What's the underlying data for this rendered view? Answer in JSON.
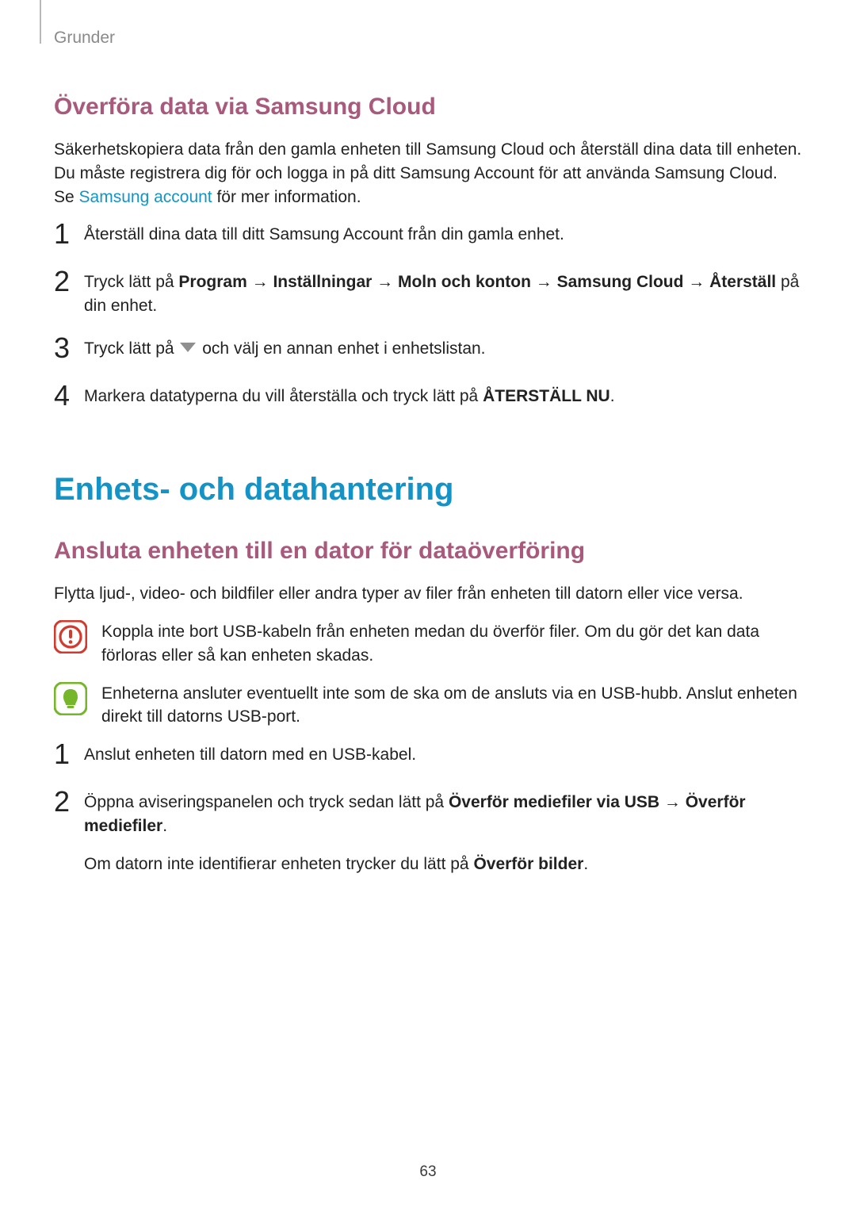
{
  "header": {
    "section_label": "Grunder"
  },
  "section1": {
    "title": "Överföra data via Samsung Cloud",
    "intro_pre": "Säkerhetskopiera data från den gamla enheten till Samsung Cloud och återställ dina data till enheten. Du måste registrera dig för och logga in på ditt Samsung Account för att använda Samsung Cloud. Se ",
    "intro_link": "Samsung account",
    "intro_post": " för mer information.",
    "steps": [
      {
        "num": "1",
        "text": "Återställ dina data till ditt Samsung Account från din gamla enhet."
      },
      {
        "num": "2",
        "pre": "Tryck lätt på ",
        "bold": "Program → Inställningar → Moln och konton → Samsung Cloud → Återställ",
        "post": " på din enhet."
      },
      {
        "num": "3",
        "pre": "Tryck lätt på ",
        "post": " och välj en annan enhet i enhetslistan.",
        "has_icon": true
      },
      {
        "num": "4",
        "pre": "Markera datatyperna du vill återställa och tryck lätt på ",
        "bold": "ÅTERSTÄLL NU",
        "post": "."
      }
    ]
  },
  "section2": {
    "title": "Enhets- och datahantering",
    "subtitle": "Ansluta enheten till en dator för dataöverföring",
    "intro": "Flytta ljud-, video- och bildfiler eller andra typer av filer från enheten till datorn eller vice versa.",
    "callouts": [
      {
        "kind": "warning",
        "text": "Koppla inte bort USB-kabeln från enheten medan du överför filer. Om du gör det kan data förloras eller så kan enheten skadas."
      },
      {
        "kind": "note",
        "text": "Enheterna ansluter eventuellt inte som de ska om de ansluts via en USB-hubb. Anslut enheten direkt till datorns USB-port."
      }
    ],
    "steps": [
      {
        "num": "1",
        "text": "Anslut enheten till datorn med en USB-kabel."
      },
      {
        "num": "2",
        "pre": "Öppna aviseringspanelen och tryck sedan lätt på ",
        "bold": "Överför mediefiler via USB → Överför mediefiler",
        "post": ".",
        "sub_pre": "Om datorn inte identifierar enheten trycker du lätt på ",
        "sub_bold": "Överför bilder",
        "sub_post": "."
      }
    ]
  },
  "page_number": "63"
}
